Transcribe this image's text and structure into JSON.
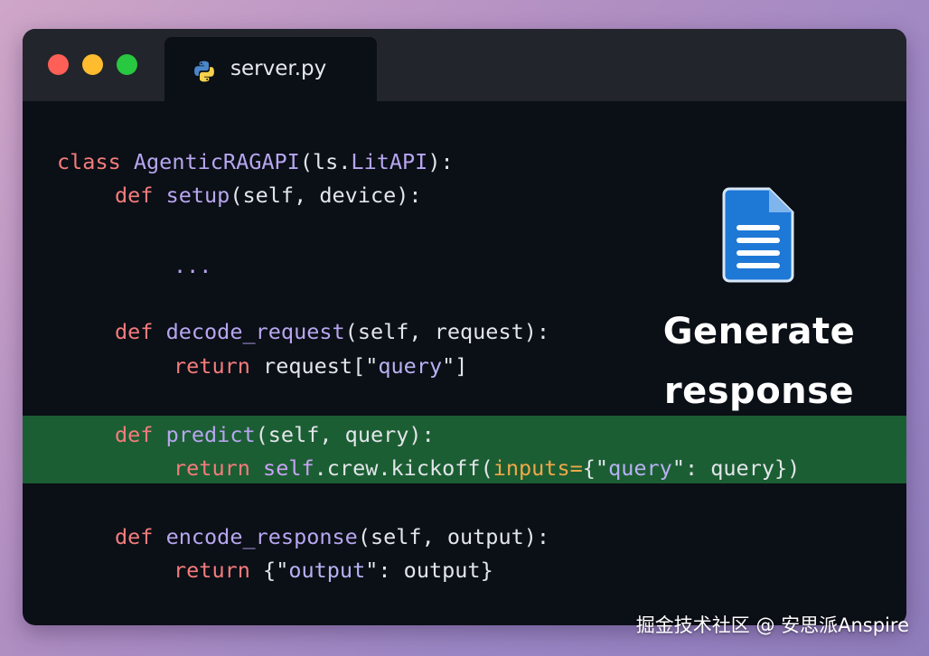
{
  "window": {
    "tab_label": "server.py",
    "tab_icon": "python-icon",
    "traffic_lights": {
      "close_color": "#fe5f57",
      "minimize_color": "#febc2e",
      "maximize_color": "#28c840"
    }
  },
  "code": {
    "language": "python",
    "highlight_color": "#1c5e33",
    "line1": {
      "kw": "class ",
      "name": "AgenticRAGAPI",
      "rest": "(ls.",
      "base": "LitAPI",
      "end": "):"
    },
    "line2": {
      "kw": "def ",
      "name": "setup",
      "rest": "(self, device):"
    },
    "line3": {
      "text": "..."
    },
    "line4": {
      "kw": "def ",
      "name": "decode_request",
      "rest": "(self, request):"
    },
    "line5": {
      "kw": "return ",
      "pre": "request[\"",
      "str": "query",
      "post": "\"]"
    },
    "line6": {
      "kw": "def ",
      "name": "predict",
      "rest": "(self, query):"
    },
    "line7": {
      "kw": "return ",
      "self": "self",
      "mid": ".crew.kickoff(",
      "param": "inputs=",
      "open": "{\"",
      "str": "query",
      "close": "\": query})"
    },
    "line8": {
      "kw": "def ",
      "name": "encode_response",
      "rest": "(self, output):"
    },
    "line9": {
      "kw": "return ",
      "open": "{\"",
      "str": "output",
      "close": "\": output}"
    }
  },
  "annotation": {
    "icon": "document-icon",
    "line1": "Generate",
    "line2": "response"
  },
  "watermark": "掘金技术社区 @ 安思派Anspire"
}
